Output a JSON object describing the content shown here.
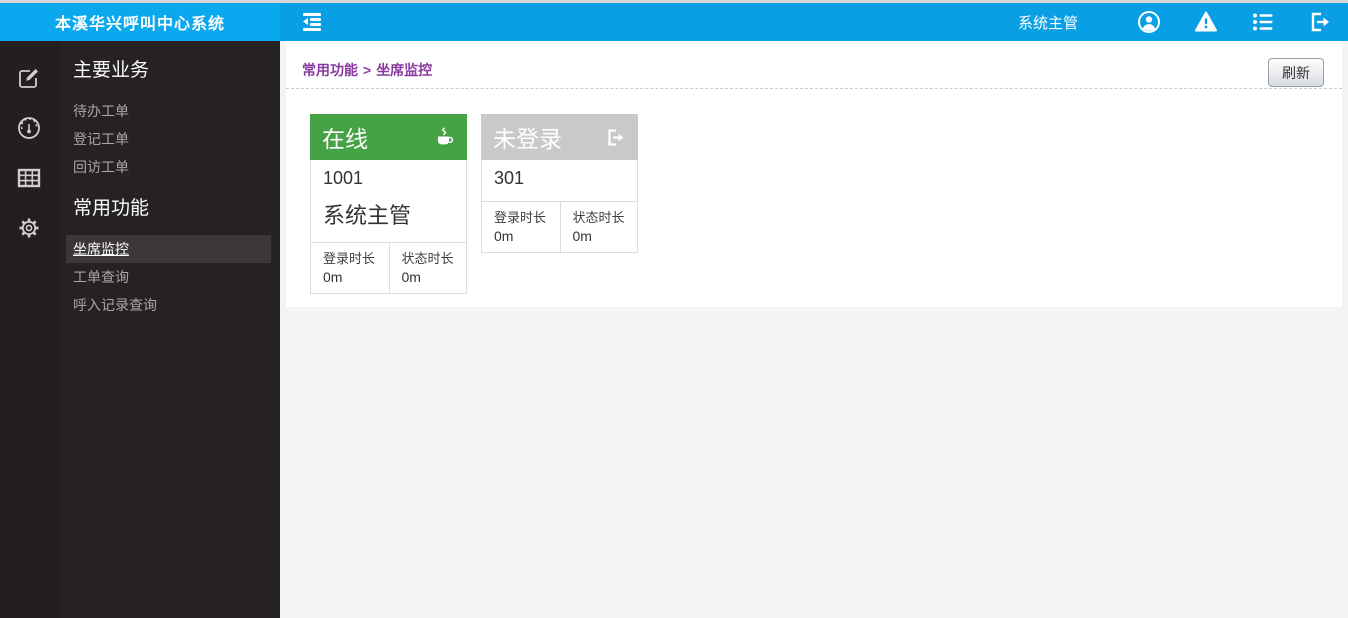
{
  "topbar": {
    "brand": "本溪华兴呼叫中心系统",
    "toggle_icon": "outdent-collapse-icon",
    "user_label": "系统主管",
    "icons": [
      "user-circle-icon",
      "warning-icon",
      "list-icon",
      "sign-out-icon"
    ]
  },
  "sidebar": {
    "rail_icons": [
      "edit-icon",
      "gauge-icon",
      "table-icon",
      "gear-icon"
    ],
    "sections": [
      {
        "header": "主要业务",
        "items": [
          {
            "label": "待办工单"
          },
          {
            "label": "登记工单"
          },
          {
            "label": "回访工单"
          }
        ]
      },
      {
        "header": "常用功能",
        "items": [
          {
            "label": "坐席监控",
            "active": true
          },
          {
            "label": "工单查询"
          },
          {
            "label": "呼入记录查询"
          }
        ]
      }
    ]
  },
  "breadcrumb": {
    "parent": "常用功能",
    "separator": ">",
    "current": "坐席监控"
  },
  "toolbar": {
    "refresh_label": "刷新"
  },
  "cards": [
    {
      "status": "在线",
      "icon": "coffee-icon",
      "header_color": "#45a245",
      "agent_id": "1001",
      "agent_name": "系统主管",
      "stats": [
        {
          "label": "登录时长",
          "value": "0m"
        },
        {
          "label": "状态时长",
          "value": "0m"
        }
      ]
    },
    {
      "status": "未登录",
      "icon": "sign-out-icon",
      "header_color": "#c9c9c9",
      "agent_id": "301",
      "stats": [
        {
          "label": "登录时长",
          "value": "0m"
        },
        {
          "label": "状态时长",
          "value": "0m"
        }
      ]
    }
  ],
  "colors": {
    "topbar_blue": "#089fe4",
    "brand_blue": "#0aa8ef",
    "online_green": "#45a245",
    "offline_gray": "#c9c9c9",
    "breadcrumb_purple": "#8a3aa0",
    "sidebar_dark": "#262223",
    "content_bg": "#f4f4f4"
  }
}
